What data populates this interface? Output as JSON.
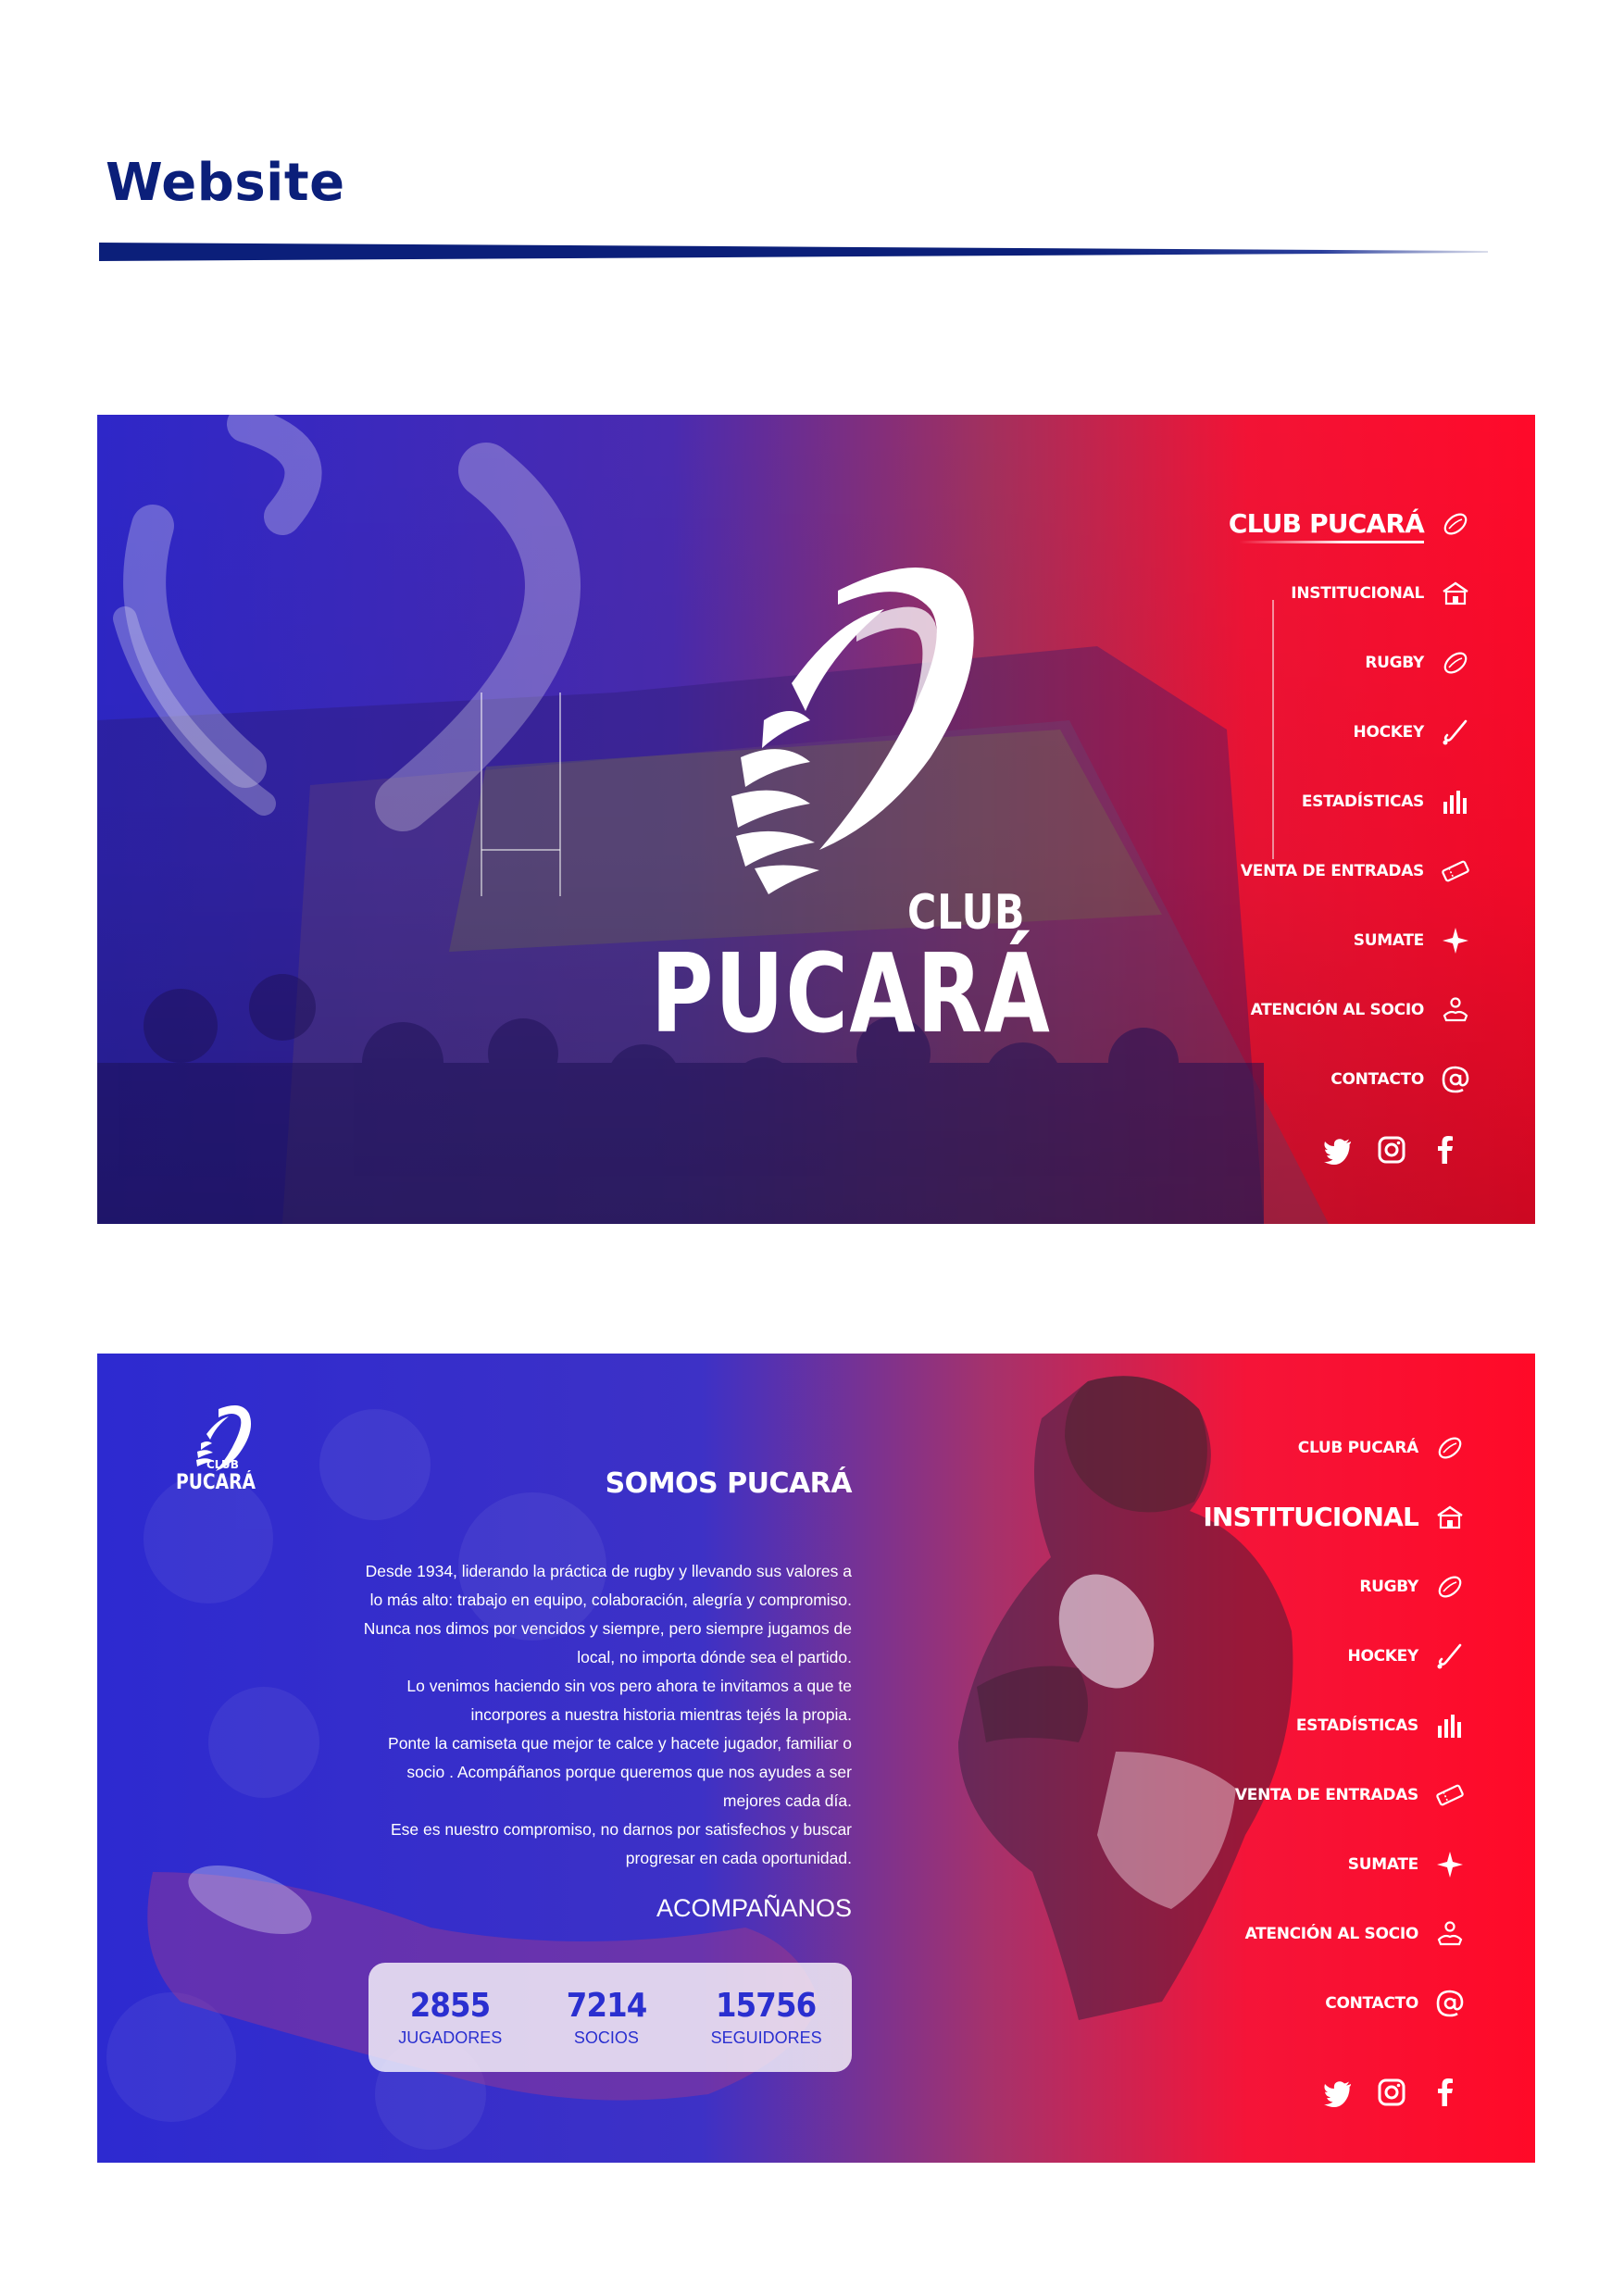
{
  "page": {
    "title": "Website"
  },
  "colors": {
    "blue": "#2a2fd0",
    "navy": "#0b1f7a",
    "red": "#ff1030"
  },
  "icons": {
    "rugby": "rugby-ball-icon",
    "institucional": "house-icon",
    "hockey": "hockey-stick-icon",
    "estadisticas": "bar-chart-icon",
    "entradas": "ticket-icon",
    "sumate": "star-icon",
    "atencion": "handshake-icon",
    "contacto": "at-sign-icon"
  },
  "social": [
    "twitter-icon",
    "instagram-icon",
    "facebook-icon"
  ],
  "nav": {
    "club_pucara": "CLUB PUCARÁ",
    "institucional": "INSTITUCIONAL",
    "rugby": "RUGBY",
    "hockey": "HOCKEY",
    "estadisticas": "ESTADÍSTICAS",
    "entradas": "VENTA DE ENTRADAS",
    "sumate": "SUMATE",
    "atencion": "ATENCIÓN AL SOCIO",
    "contacto": "CONTACTO"
  },
  "hero": {
    "club": "CLUB",
    "name": "PUCARÁ"
  },
  "about": {
    "heading": "SOMOS PUCARÁ",
    "paragraphs": [
      "Desde 1934, liderando la práctica de rugby y llevando sus valores a lo más alto: trabajo en equipo, colaboración, alegría y compromiso. Nunca nos dimos por vencidos y siempre, pero siempre jugamos de local, no importa dónde sea el partido.",
      "Lo venimos haciendo sin vos pero ahora te invitamos a que te incorpores a nuestra historia mientras tejés la propia.",
      "Ponte la camiseta que mejor te calce y hacete jugador, familiar o socio . Acompáñanos porque queremos que nos ayudes a ser mejores cada día.",
      "Ese es nuestro compromiso, no darnos por satisfechos y buscar progresar en cada oportunidad."
    ],
    "cta": "ACOMPAÑANOS",
    "stats": [
      {
        "value": "2855",
        "label": "JUGADORES"
      },
      {
        "value": "7214",
        "label": "SOCIOS"
      },
      {
        "value": "15756",
        "label": "SEGUIDORES"
      }
    ]
  }
}
